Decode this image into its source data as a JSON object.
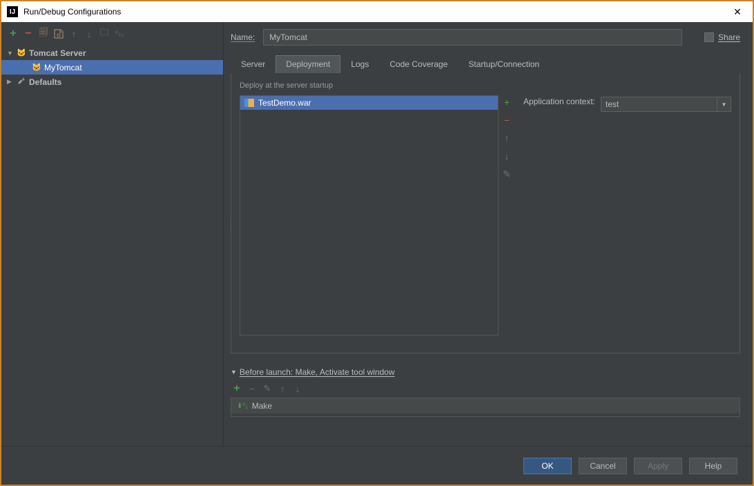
{
  "titlebar": {
    "icon_text": "IJ",
    "title": "Run/Debug Configurations"
  },
  "left": {
    "tree": [
      {
        "label": "Tomcat Server",
        "expanded": true,
        "icon": "tomcat",
        "bold": true
      },
      {
        "label": "MyTomcat",
        "icon": "tomcat",
        "selected": true,
        "indent": 1
      },
      {
        "label": "Defaults",
        "expanded": false,
        "icon": "wrench",
        "bold": true
      }
    ]
  },
  "right": {
    "name_label": "Name:",
    "name_value": "MyTomcat",
    "share_label": "Share",
    "tabs": [
      "Server",
      "Deployment",
      "Logs",
      "Code Coverage",
      "Startup/Connection"
    ],
    "active_tab": "Deployment",
    "deploy_section_label": "Deploy at the server startup",
    "deploy_items": [
      "TestDemo.war"
    ],
    "context_label": "Application context:",
    "context_value": "test",
    "before_launch_header": "Before launch: Make, Activate tool window",
    "before_launch_items": [
      "Make"
    ]
  },
  "buttons": {
    "ok": "OK",
    "cancel": "Cancel",
    "apply": "Apply",
    "help": "Help"
  }
}
